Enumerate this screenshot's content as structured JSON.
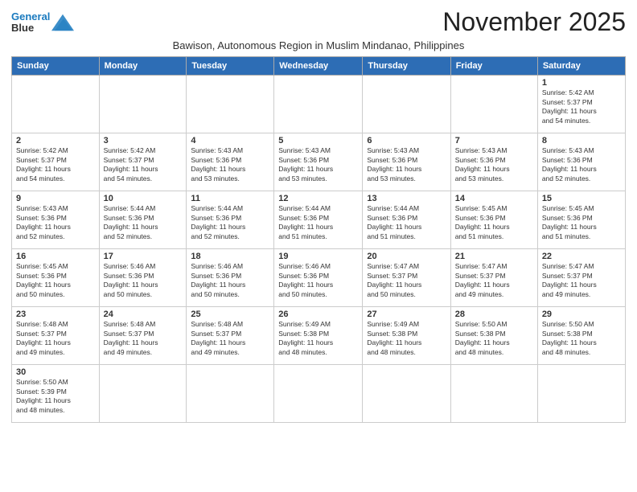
{
  "header": {
    "logo_line1": "General",
    "logo_line2": "Blue",
    "month_title": "November 2025",
    "subtitle": "Bawison, Autonomous Region in Muslim Mindanao, Philippines"
  },
  "days_of_week": [
    "Sunday",
    "Monday",
    "Tuesday",
    "Wednesday",
    "Thursday",
    "Friday",
    "Saturday"
  ],
  "weeks": [
    [
      {
        "day": "",
        "info": ""
      },
      {
        "day": "",
        "info": ""
      },
      {
        "day": "",
        "info": ""
      },
      {
        "day": "",
        "info": ""
      },
      {
        "day": "",
        "info": ""
      },
      {
        "day": "",
        "info": ""
      },
      {
        "day": "1",
        "info": "Sunrise: 5:42 AM\nSunset: 5:37 PM\nDaylight: 11 hours\nand 54 minutes."
      }
    ],
    [
      {
        "day": "2",
        "info": "Sunrise: 5:42 AM\nSunset: 5:37 PM\nDaylight: 11 hours\nand 54 minutes."
      },
      {
        "day": "3",
        "info": "Sunrise: 5:42 AM\nSunset: 5:37 PM\nDaylight: 11 hours\nand 54 minutes."
      },
      {
        "day": "4",
        "info": "Sunrise: 5:43 AM\nSunset: 5:36 PM\nDaylight: 11 hours\nand 53 minutes."
      },
      {
        "day": "5",
        "info": "Sunrise: 5:43 AM\nSunset: 5:36 PM\nDaylight: 11 hours\nand 53 minutes."
      },
      {
        "day": "6",
        "info": "Sunrise: 5:43 AM\nSunset: 5:36 PM\nDaylight: 11 hours\nand 53 minutes."
      },
      {
        "day": "7",
        "info": "Sunrise: 5:43 AM\nSunset: 5:36 PM\nDaylight: 11 hours\nand 53 minutes."
      },
      {
        "day": "8",
        "info": "Sunrise: 5:43 AM\nSunset: 5:36 PM\nDaylight: 11 hours\nand 52 minutes."
      }
    ],
    [
      {
        "day": "9",
        "info": "Sunrise: 5:43 AM\nSunset: 5:36 PM\nDaylight: 11 hours\nand 52 minutes."
      },
      {
        "day": "10",
        "info": "Sunrise: 5:44 AM\nSunset: 5:36 PM\nDaylight: 11 hours\nand 52 minutes."
      },
      {
        "day": "11",
        "info": "Sunrise: 5:44 AM\nSunset: 5:36 PM\nDaylight: 11 hours\nand 52 minutes."
      },
      {
        "day": "12",
        "info": "Sunrise: 5:44 AM\nSunset: 5:36 PM\nDaylight: 11 hours\nand 51 minutes."
      },
      {
        "day": "13",
        "info": "Sunrise: 5:44 AM\nSunset: 5:36 PM\nDaylight: 11 hours\nand 51 minutes."
      },
      {
        "day": "14",
        "info": "Sunrise: 5:45 AM\nSunset: 5:36 PM\nDaylight: 11 hours\nand 51 minutes."
      },
      {
        "day": "15",
        "info": "Sunrise: 5:45 AM\nSunset: 5:36 PM\nDaylight: 11 hours\nand 51 minutes."
      }
    ],
    [
      {
        "day": "16",
        "info": "Sunrise: 5:45 AM\nSunset: 5:36 PM\nDaylight: 11 hours\nand 50 minutes."
      },
      {
        "day": "17",
        "info": "Sunrise: 5:46 AM\nSunset: 5:36 PM\nDaylight: 11 hours\nand 50 minutes."
      },
      {
        "day": "18",
        "info": "Sunrise: 5:46 AM\nSunset: 5:36 PM\nDaylight: 11 hours\nand 50 minutes."
      },
      {
        "day": "19",
        "info": "Sunrise: 5:46 AM\nSunset: 5:36 PM\nDaylight: 11 hours\nand 50 minutes."
      },
      {
        "day": "20",
        "info": "Sunrise: 5:47 AM\nSunset: 5:37 PM\nDaylight: 11 hours\nand 50 minutes."
      },
      {
        "day": "21",
        "info": "Sunrise: 5:47 AM\nSunset: 5:37 PM\nDaylight: 11 hours\nand 49 minutes."
      },
      {
        "day": "22",
        "info": "Sunrise: 5:47 AM\nSunset: 5:37 PM\nDaylight: 11 hours\nand 49 minutes."
      }
    ],
    [
      {
        "day": "23",
        "info": "Sunrise: 5:48 AM\nSunset: 5:37 PM\nDaylight: 11 hours\nand 49 minutes."
      },
      {
        "day": "24",
        "info": "Sunrise: 5:48 AM\nSunset: 5:37 PM\nDaylight: 11 hours\nand 49 minutes."
      },
      {
        "day": "25",
        "info": "Sunrise: 5:48 AM\nSunset: 5:37 PM\nDaylight: 11 hours\nand 49 minutes."
      },
      {
        "day": "26",
        "info": "Sunrise: 5:49 AM\nSunset: 5:38 PM\nDaylight: 11 hours\nand 48 minutes."
      },
      {
        "day": "27",
        "info": "Sunrise: 5:49 AM\nSunset: 5:38 PM\nDaylight: 11 hours\nand 48 minutes."
      },
      {
        "day": "28",
        "info": "Sunrise: 5:50 AM\nSunset: 5:38 PM\nDaylight: 11 hours\nand 48 minutes."
      },
      {
        "day": "29",
        "info": "Sunrise: 5:50 AM\nSunset: 5:38 PM\nDaylight: 11 hours\nand 48 minutes."
      }
    ],
    [
      {
        "day": "30",
        "info": "Sunrise: 5:50 AM\nSunset: 5:39 PM\nDaylight: 11 hours\nand 48 minutes."
      },
      {
        "day": "",
        "info": ""
      },
      {
        "day": "",
        "info": ""
      },
      {
        "day": "",
        "info": ""
      },
      {
        "day": "",
        "info": ""
      },
      {
        "day": "",
        "info": ""
      },
      {
        "day": "",
        "info": ""
      }
    ]
  ]
}
